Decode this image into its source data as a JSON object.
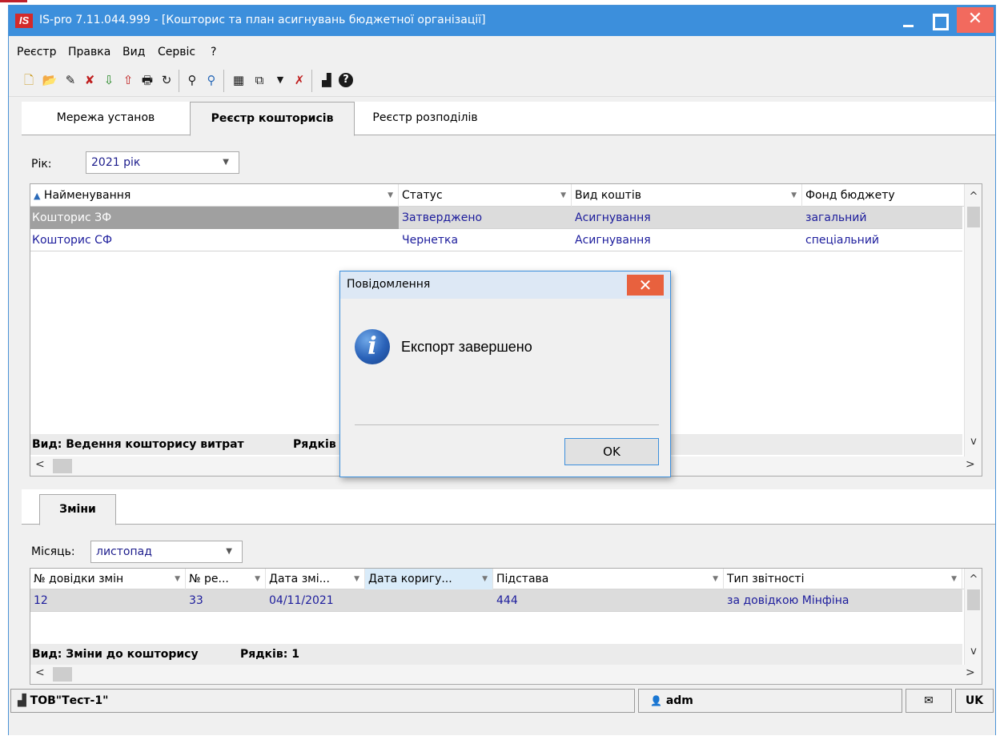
{
  "window": {
    "logo": "IS",
    "title": "IS-pro 7.11.044.999 - [Кошторис та план асигнувань бюджетної організації]",
    "close_glyph": "✕"
  },
  "menu": [
    "Реєстр",
    "Правка",
    "Вид",
    "Сервіс",
    "?"
  ],
  "toolbar": {
    "icons": [
      "new-document-icon",
      "open-folder-icon",
      "edit-document-icon",
      "delete-document-icon",
      "export-dbf-icon",
      "import-dbf-icon",
      "print-icon",
      "refresh-icon",
      "find-icon",
      "find-next-icon",
      "table-icon",
      "copy-window-icon",
      "filter-icon",
      "clear-filter-icon",
      "chart-icon",
      "help-icon"
    ],
    "glyphs": [
      "🗋",
      "📂",
      "✎",
      "✘",
      "⇩",
      "⇧",
      "🖶",
      "↻",
      "⚲",
      "⚲",
      "▦",
      "⧉",
      "▼",
      "✗",
      "▟",
      "?"
    ]
  },
  "top_tabs": [
    "Мережа установ",
    "Реєстр кошторисів",
    "Реєстр розподілів"
  ],
  "year": {
    "label": "Рік:",
    "value": "2021 рік",
    "arrow": "▼"
  },
  "grid1": {
    "sort_glyph": "▲",
    "filter_glyph": "▼",
    "columns": [
      "Найменування",
      "Статус",
      "Вид коштів",
      "Фонд бюджету"
    ],
    "rows": [
      [
        "Кошторис ЗФ",
        "Затверджено",
        "Асигнування",
        "загальний"
      ],
      [
        "Кошторис СФ",
        "Чернетка",
        "Асигнування",
        "спеціальний"
      ]
    ],
    "footer_view": "Вид: Ведення кошторису витрат",
    "footer_rows": "Рядків"
  },
  "scroll": {
    "up": "^",
    "down": "v",
    "left": "<",
    "right": ">"
  },
  "bottom_tab": "Зміни",
  "month": {
    "label": "Місяць:",
    "value": "листопад",
    "arrow": "▼"
  },
  "grid2": {
    "filter_glyph": "▼",
    "columns": [
      "№ довідки змін",
      "№ ре...",
      "Дата змі...",
      "Дата коригу...",
      "Підстава",
      "Тип звітності"
    ],
    "rows": [
      [
        "12",
        "33",
        "04/11/2021",
        "",
        "444",
        "за довідкою Мінфіна"
      ]
    ],
    "footer_view": "Вид: Зміни до кошторису",
    "footer_rows": "Рядків: 1"
  },
  "status": {
    "company": "ТОВ\"Тест-1\"",
    "user": "adm",
    "lang": "UK",
    "mail_glyph": "✉",
    "user_glyph": "👤",
    "chart_glyph": "▟"
  },
  "dialog": {
    "title": "Повідомлення",
    "close_glyph": "✕",
    "icon": "i",
    "message": "Експорт завершено",
    "ok": "OK"
  }
}
